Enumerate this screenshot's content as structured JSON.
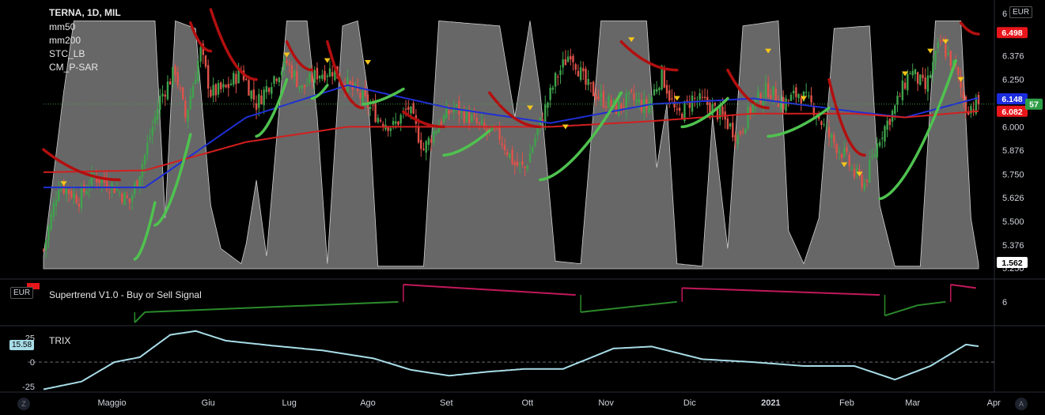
{
  "header": {
    "symbol": "TERNA, 1D, MIL",
    "indicators": [
      "mm50",
      "mm200",
      "STC_LB",
      "CM_P-SAR"
    ],
    "currency": "EUR"
  },
  "colors": {
    "background": "#000000",
    "up": "#3fa34d",
    "down": "#e0524a",
    "ma50": "#1f2fd4",
    "ma200": "#d31f1f",
    "sar_bear": "#b30f0f",
    "sar_bull": "#4fc24f",
    "stc_fill": "#8a8a8a",
    "trix": "#a8dde8",
    "st_bull": "#2b8a2b",
    "st_bear": "#c2185b"
  },
  "price_axis": {
    "labels": [
      "6.376",
      "6.250",
      "6.000",
      "5.876",
      "5.750",
      "5.626",
      "5.500",
      "5.376"
    ],
    "top_partial": "6",
    "bottom_partial": "5.250"
  },
  "price_tags": [
    {
      "name": "sar-tag",
      "text": "6.498",
      "bg": "#e8161b",
      "fg": "#ffffff"
    },
    {
      "name": "ma50-tag",
      "text": "6.148",
      "bg": "#1b2bdd",
      "fg": "#ffffff"
    },
    {
      "name": "ma200-tag",
      "text": "6.082",
      "bg": "#e8161b",
      "fg": "#ffffff"
    },
    {
      "name": "stc-tag",
      "text": "1.562",
      "bg": "#ffffff",
      "fg": "#000000"
    },
    {
      "name": "last-tag",
      "text": "57",
      "bg": "#2e9f46",
      "fg": "#ffffff"
    }
  ],
  "supertrend": {
    "title": "Supertrend V1.0 - Buy or Sell Signal",
    "currency": "EUR",
    "axis_label": "6"
  },
  "trix": {
    "title": "TRIX",
    "value_tag": "15.58",
    "axis_labels": [
      "25",
      "0",
      "-25"
    ]
  },
  "x_axis": {
    "labels": [
      "Maggio",
      "Giu",
      "Lug",
      "Ago",
      "Set",
      "Ott",
      "Nov",
      "Dic",
      "2021",
      "Feb",
      "Mar",
      "Apr"
    ]
  },
  "corners": {
    "left": "Z",
    "right": "A"
  },
  "chart_data": {
    "type": "candlestick",
    "title": "TERNA, 1D, MIL",
    "ylim": [
      5.25,
      6.62
    ],
    "x_months": [
      "Maggio",
      "Giu",
      "Lug",
      "Ago",
      "Set",
      "Ott",
      "Nov",
      "Dic",
      "2021",
      "Feb",
      "Mar",
      "Apr"
    ],
    "close_anchors": [
      [
        0,
        5.35
      ],
      [
        6,
        5.7
      ],
      [
        14,
        5.62
      ],
      [
        20,
        5.74
      ],
      [
        28,
        5.68
      ],
      [
        34,
        5.6
      ],
      [
        40,
        5.85
      ],
      [
        46,
        6.15
      ],
      [
        52,
        6.3
      ],
      [
        56,
        6.05
      ],
      [
        62,
        6.4
      ],
      [
        66,
        6.18
      ],
      [
        72,
        6.2
      ],
      [
        78,
        6.3
      ],
      [
        84,
        6.12
      ],
      [
        90,
        6.25
      ],
      [
        96,
        6.34
      ],
      [
        102,
        6.2
      ],
      [
        108,
        6.28
      ],
      [
        114,
        6.3
      ],
      [
        120,
        6.22
      ],
      [
        126,
        6.15
      ],
      [
        132,
        6.05
      ],
      [
        138,
        6.0
      ],
      [
        144,
        6.1
      ],
      [
        150,
        5.88
      ],
      [
        156,
        6.02
      ],
      [
        162,
        6.1
      ],
      [
        168,
        6.05
      ],
      [
        174,
        5.98
      ],
      [
        180,
        5.95
      ],
      [
        186,
        5.8
      ],
      [
        190,
        5.78
      ],
      [
        196,
        6.02
      ],
      [
        202,
        6.25
      ],
      [
        208,
        6.4
      ],
      [
        214,
        6.22
      ],
      [
        220,
        6.15
      ],
      [
        226,
        6.1
      ],
      [
        232,
        6.15
      ],
      [
        238,
        6.1
      ],
      [
        244,
        6.28
      ],
      [
        250,
        6.05
      ],
      [
        256,
        6.15
      ],
      [
        262,
        6.12
      ],
      [
        268,
        6.05
      ],
      [
        274,
        5.95
      ],
      [
        280,
        6.12
      ],
      [
        286,
        6.2
      ],
      [
        292,
        6.12
      ],
      [
        298,
        6.18
      ],
      [
        304,
        6.1
      ],
      [
        310,
        5.95
      ],
      [
        316,
        5.85
      ],
      [
        320,
        5.75
      ],
      [
        324,
        5.7
      ],
      [
        330,
        5.95
      ],
      [
        336,
        6.1
      ],
      [
        342,
        6.3
      ],
      [
        348,
        6.2
      ],
      [
        354,
        6.45
      ],
      [
        360,
        6.3
      ],
      [
        364,
        6.1
      ],
      [
        368,
        6.12
      ]
    ],
    "series": [
      {
        "name": "mm50",
        "y": [
          [
            0,
            5.68
          ],
          [
            40,
            5.68
          ],
          [
            80,
            6.05
          ],
          [
            120,
            6.22
          ],
          [
            160,
            6.1
          ],
          [
            200,
            6.02
          ],
          [
            240,
            6.12
          ],
          [
            280,
            6.15
          ],
          [
            320,
            6.08
          ],
          [
            340,
            6.05
          ],
          [
            368,
            6.15
          ]
        ]
      },
      {
        "name": "mm200",
        "y": [
          [
            0,
            5.76
          ],
          [
            40,
            5.77
          ],
          [
            80,
            5.92
          ],
          [
            120,
            6.0
          ],
          [
            160,
            6.0
          ],
          [
            200,
            6.0
          ],
          [
            240,
            6.03
          ],
          [
            280,
            6.07
          ],
          [
            320,
            6.07
          ],
          [
            340,
            6.05
          ],
          [
            368,
            6.082
          ]
        ]
      },
      {
        "name": "STC_LB",
        "scale": "0-100"
      },
      {
        "name": "CM_P-SAR",
        "last": 6.498
      }
    ],
    "trix_ylim": [
      -30,
      35
    ],
    "trix_anchors": [
      [
        0,
        -28
      ],
      [
        15,
        -20
      ],
      [
        28,
        0
      ],
      [
        38,
        5
      ],
      [
        50,
        28
      ],
      [
        60,
        32
      ],
      [
        72,
        22
      ],
      [
        90,
        17
      ],
      [
        110,
        12
      ],
      [
        130,
        4
      ],
      [
        145,
        -8
      ],
      [
        160,
        -14
      ],
      [
        175,
        -10
      ],
      [
        190,
        -7
      ],
      [
        205,
        -7
      ],
      [
        225,
        14
      ],
      [
        240,
        16
      ],
      [
        260,
        3
      ],
      [
        280,
        0
      ],
      [
        300,
        -4
      ],
      [
        320,
        -4
      ],
      [
        336,
        -18
      ],
      [
        350,
        -4
      ],
      [
        364,
        18
      ],
      [
        370,
        16
      ]
    ],
    "supertrend_levels": [
      [
        0,
        5.55,
        "bear"
      ],
      [
        36,
        5.4,
        "bull"
      ],
      [
        40,
        5.55,
        "bull"
      ],
      [
        140,
        5.7,
        "bull"
      ],
      [
        142,
        5.95,
        "bear"
      ],
      [
        210,
        5.8,
        "bear"
      ],
      [
        212,
        5.55,
        "bull"
      ],
      [
        250,
        5.7,
        "bull"
      ],
      [
        252,
        5.9,
        "bear"
      ],
      [
        330,
        5.8,
        "bear"
      ],
      [
        332,
        5.5,
        "bull"
      ],
      [
        345,
        5.65,
        "bull"
      ],
      [
        356,
        5.7,
        "bull"
      ],
      [
        358,
        5.95,
        "bear"
      ]
    ]
  }
}
